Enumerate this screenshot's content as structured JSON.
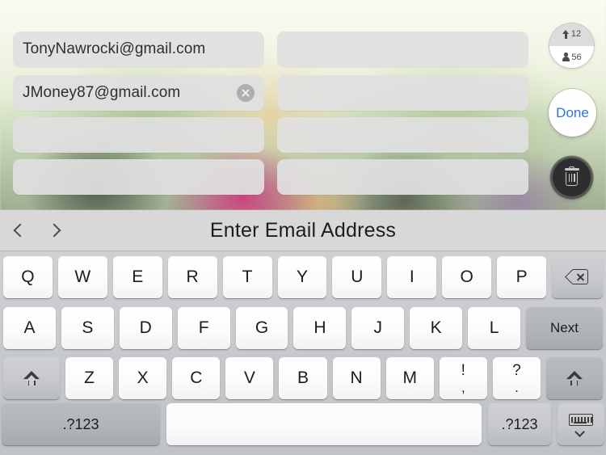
{
  "colors": {
    "done_text": "#2b74e8",
    "field_bg": "#e0e0e0",
    "keyboard_bg": "#c9cbce",
    "toolbar_bg": "#d8d8d8",
    "delete_circle": "#2e2e30"
  },
  "form": {
    "fields": [
      {
        "value": "TonyNawrocki@gmail.com",
        "has_clear": false,
        "column": "left",
        "row": 0
      },
      {
        "value": "JMoney87@gmail.com",
        "has_clear": true,
        "column": "left",
        "row": 1
      },
      {
        "value": "",
        "has_clear": false,
        "column": "left",
        "row": 2
      },
      {
        "value": "",
        "has_clear": false,
        "column": "left",
        "row": 3
      },
      {
        "value": "",
        "has_clear": false,
        "column": "right",
        "row": 0
      },
      {
        "value": "",
        "has_clear": false,
        "column": "right",
        "row": 1
      },
      {
        "value": "",
        "has_clear": false,
        "column": "right",
        "row": 2
      },
      {
        "value": "",
        "has_clear": false,
        "column": "right",
        "row": 3
      }
    ]
  },
  "controls": {
    "stats": {
      "uploads_icon": "arrow-up-icon",
      "uploads_count": "12",
      "people_icon": "person-icon",
      "people_count": "56"
    },
    "done_label": "Done",
    "delete_icon": "trash-icon"
  },
  "keyboard": {
    "toolbar": {
      "prev_icon": "chevron-left-icon",
      "next_icon": "chevron-right-icon",
      "title": "Enter Email Address"
    },
    "row1": [
      "Q",
      "W",
      "E",
      "R",
      "T",
      "Y",
      "U",
      "I",
      "O",
      "P"
    ],
    "row1_action": {
      "label": "",
      "icon": "backspace-icon"
    },
    "row2": [
      "A",
      "S",
      "D",
      "F",
      "G",
      "H",
      "J",
      "K",
      "L"
    ],
    "row2_action": {
      "label": "Next"
    },
    "row3": [
      "Z",
      "X",
      "C",
      "V",
      "B",
      "N",
      "M"
    ],
    "row3_dual": [
      {
        "upper": "!",
        "lower": ","
      },
      {
        "upper": "?",
        "lower": "."
      }
    ],
    "shift_left_icon": "shift-icon",
    "shift_right_icon": "shift-icon",
    "row4": {
      "numbers_left": ".?123",
      "space": "",
      "numbers_right": ".?123",
      "hide_icon": "hide-keyboard-icon"
    }
  }
}
